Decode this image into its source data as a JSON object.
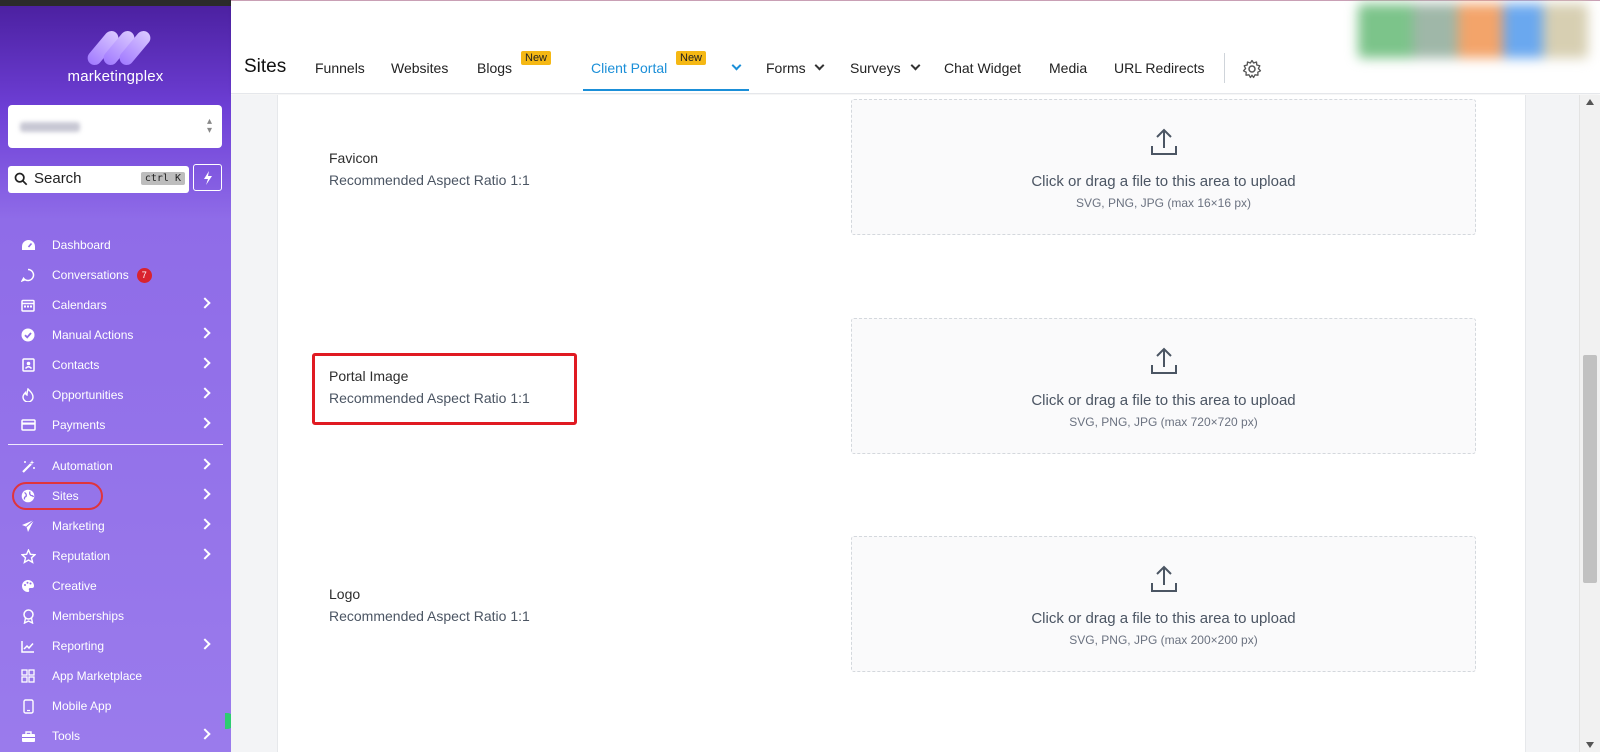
{
  "sidebar": {
    "brand": "marketingplex",
    "search_label": "Search",
    "search_shortcut": "ctrl K",
    "items": [
      {
        "label": "Dashboard",
        "icon": "dashboard-icon"
      },
      {
        "label": "Conversations",
        "icon": "chat-bubble-icon",
        "badge": "7"
      },
      {
        "label": "Calendars",
        "icon": "calendar-icon"
      },
      {
        "label": "Manual Actions",
        "icon": "check-circle-icon"
      },
      {
        "label": "Contacts",
        "icon": "contact-card-icon"
      },
      {
        "label": "Opportunities",
        "icon": "flame-icon"
      },
      {
        "label": "Payments",
        "icon": "credit-card-icon"
      },
      {
        "label": "Automation",
        "icon": "magic-wand-icon"
      },
      {
        "label": "Sites",
        "icon": "globe-icon"
      },
      {
        "label": "Marketing",
        "icon": "paper-plane-icon"
      },
      {
        "label": "Reputation",
        "icon": "star-icon"
      },
      {
        "label": "Creative",
        "icon": "palette-icon"
      },
      {
        "label": "Memberships",
        "icon": "award-icon"
      },
      {
        "label": "Reporting",
        "icon": "chart-icon"
      },
      {
        "label": "App Marketplace",
        "icon": "grid-icon"
      },
      {
        "label": "Mobile App",
        "icon": "phone-icon"
      },
      {
        "label": "Tools",
        "icon": "toolbox-icon"
      }
    ]
  },
  "header": {
    "title": "Sites",
    "tabs": {
      "funnels": "Funnels",
      "websites": "Websites",
      "blogs": "Blogs",
      "client_portal": "Client Portal",
      "forms": "Forms",
      "surveys": "Surveys",
      "chat_widget": "Chat Widget",
      "media": "Media",
      "url_redirects": "URL Redirects"
    },
    "new_tag": "New"
  },
  "uploads": [
    {
      "label": "Favicon",
      "ratio": "Recommended Aspect Ratio 1:1",
      "cta": "Click or drag a file to this area to upload",
      "hint": "SVG, PNG, JPG (max 16×16 px)"
    },
    {
      "label": "Portal Image",
      "ratio": "Recommended Aspect Ratio 1:1",
      "cta": "Click or drag a file to this area to upload",
      "hint": "SVG, PNG, JPG (max 720×720 px)"
    },
    {
      "label": "Logo",
      "ratio": "Recommended Aspect Ratio 1:1",
      "cta": "Click or drag a file to this area to upload",
      "hint": "SVG, PNG, JPG (max 200×200 px)"
    }
  ],
  "colors": {
    "accent": "#1b8fd8",
    "highlight": "#e01a22",
    "tag": "#f5b814"
  }
}
